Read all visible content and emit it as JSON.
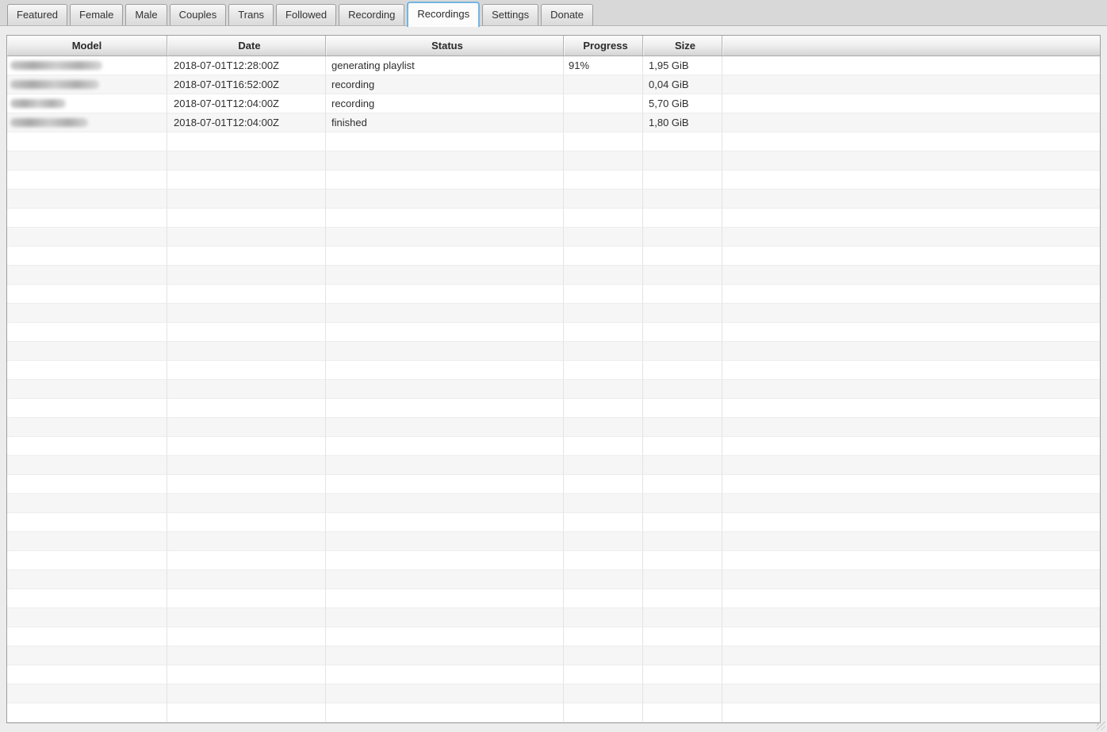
{
  "tabs": {
    "items": [
      {
        "label": "Featured",
        "active": false
      },
      {
        "label": "Female",
        "active": false
      },
      {
        "label": "Male",
        "active": false
      },
      {
        "label": "Couples",
        "active": false
      },
      {
        "label": "Trans",
        "active": false
      },
      {
        "label": "Followed",
        "active": false
      },
      {
        "label": "Recording",
        "active": false
      },
      {
        "label": "Recordings",
        "active": true
      },
      {
        "label": "Settings",
        "active": false
      },
      {
        "label": "Donate",
        "active": false
      }
    ],
    "active_label": "Recordings"
  },
  "table": {
    "columns": [
      {
        "key": "model",
        "label": "Model"
      },
      {
        "key": "date",
        "label": "Date"
      },
      {
        "key": "status",
        "label": "Status"
      },
      {
        "key": "progress",
        "label": "Progress"
      },
      {
        "key": "size",
        "label": "Size"
      },
      {
        "key": "extra",
        "label": ""
      }
    ],
    "rows": [
      {
        "model": "",
        "model_redacted": true,
        "model_blur_width": 116,
        "date": "2018-07-01T12:28:00Z",
        "status": "generating playlist",
        "progress": "91%",
        "size": "1,95 GiB",
        "extra": ""
      },
      {
        "model": "",
        "model_redacted": true,
        "model_blur_width": 112,
        "date": "2018-07-01T16:52:00Z",
        "status": "recording",
        "progress": "",
        "size": "0,04 GiB",
        "extra": ""
      },
      {
        "model": "",
        "model_redacted": true,
        "model_blur_width": 70,
        "date": "2018-07-01T12:04:00Z",
        "status": "recording",
        "progress": "",
        "size": "5,70 GiB",
        "extra": ""
      },
      {
        "model": "",
        "model_redacted": true,
        "model_blur_width": 98,
        "date": "2018-07-01T12:04:00Z",
        "status": "finished",
        "progress": "",
        "size": "1,80 GiB",
        "extra": ""
      }
    ],
    "total_visible_rows": 35
  },
  "colors": {
    "active_tab_border": "#74b4e0",
    "tabbar_background": "#d8d8d8",
    "window_background": "#ececec",
    "row_alt_background": "#f6f6f6",
    "header_border": "#ababab",
    "table_border": "#9e9e9e"
  }
}
